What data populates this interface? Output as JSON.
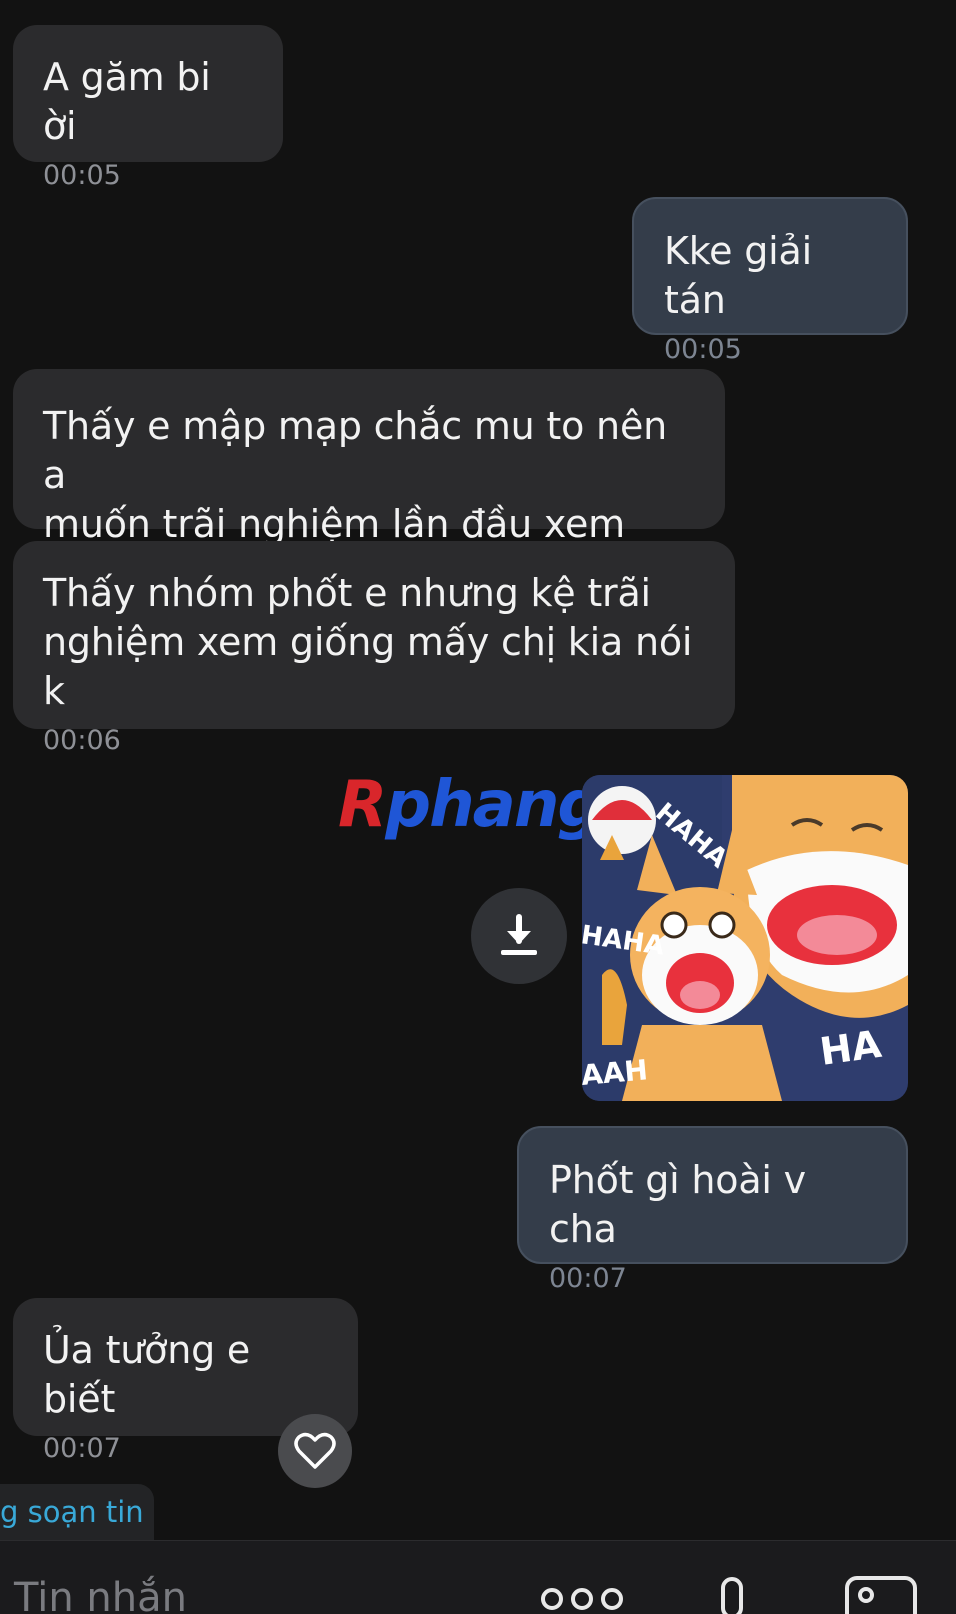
{
  "messages": [
    {
      "text": "A găm bi ời",
      "time": "00:05",
      "side": "incoming"
    },
    {
      "text": "Kke giải tán",
      "time": "00:05",
      "side": "outgoing"
    },
    {
      "text": "Thấy e mập mạp chắc mu to nên a\nmuốn trãi nghiệm lần đầu xem sao",
      "time": "",
      "side": "incoming"
    },
    {
      "text": "Thấy nhóm phốt e nhưng kệ trãi\nnghiệm xem giống mấy chị kia nói k",
      "time": "00:06",
      "side": "incoming"
    },
    {
      "text": "Phốt gì hoài v cha",
      "time": "00:07",
      "side": "outgoing"
    },
    {
      "text": "Ủa tưởng e biết",
      "time": "00:07",
      "side": "incoming"
    }
  ],
  "sticker": {
    "text_1": "HAHA",
    "text_2": "HAHA",
    "text_3": "HA",
    "text_4": "AAH"
  },
  "watermark": {
    "r": "R",
    "rest": "phang"
  },
  "typing_indicator": "g soạn tin",
  "composer": {
    "placeholder": "Tin nhắn"
  },
  "icons": {
    "download": "download-icon",
    "heart": "heart-icon",
    "more": "more-dots-icon",
    "mic": "microphone-icon",
    "gallery": "image-icon"
  },
  "colors": {
    "background": "#121212",
    "incoming_bubble": "#2b2b2d",
    "outgoing_bubble": "#343d4a",
    "typing_text": "#39a9d8"
  }
}
